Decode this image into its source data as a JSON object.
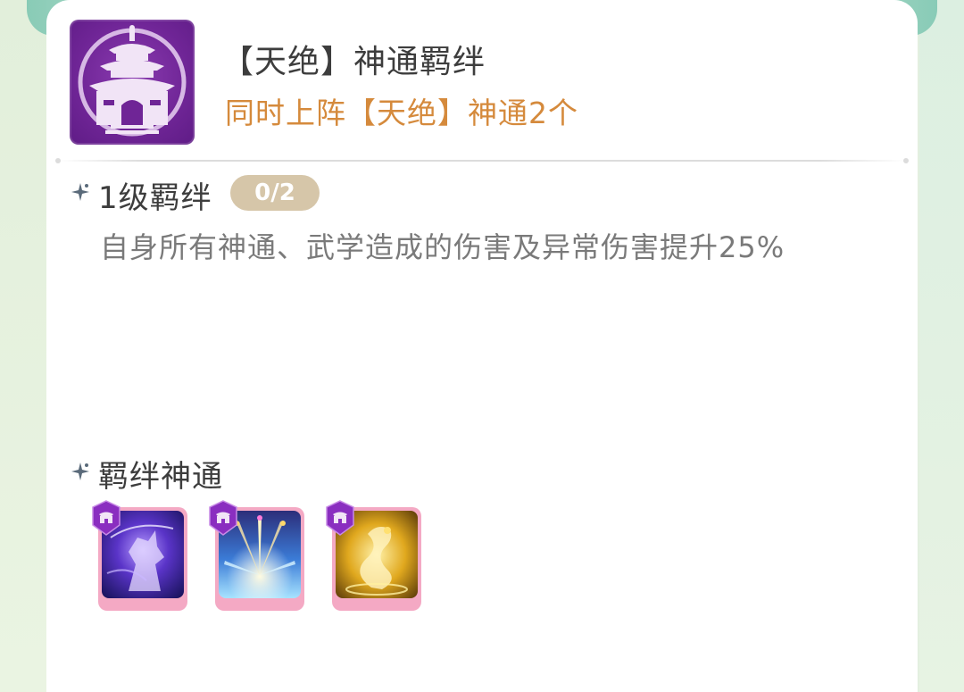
{
  "bond": {
    "title": "【天绝】神通羁绊",
    "subtitle": "同时上阵【天绝】神通2个",
    "icon": "palace-icon",
    "icon_color": "#6f2596"
  },
  "level1": {
    "title": "1级羁绊",
    "progress": "0/2",
    "description": "自身所有神通、武学造成的伤害及异常伤害提升25%"
  },
  "skills_section": {
    "title": "羁绊神通",
    "skills": [
      {
        "name": "shadow-warrior-skill-icon",
        "theme": "#5a34c8"
      },
      {
        "name": "light-burst-skill-icon",
        "theme": "#3b7bd6"
      },
      {
        "name": "golden-dragon-skill-icon",
        "theme": "#e0a81e"
      }
    ]
  },
  "colors": {
    "title": "#3d3d3d",
    "subtitle": "#d58a3c",
    "badge": "#d6c6a9",
    "description": "#7a7a7a",
    "card_frame": "#f4a9c4"
  }
}
